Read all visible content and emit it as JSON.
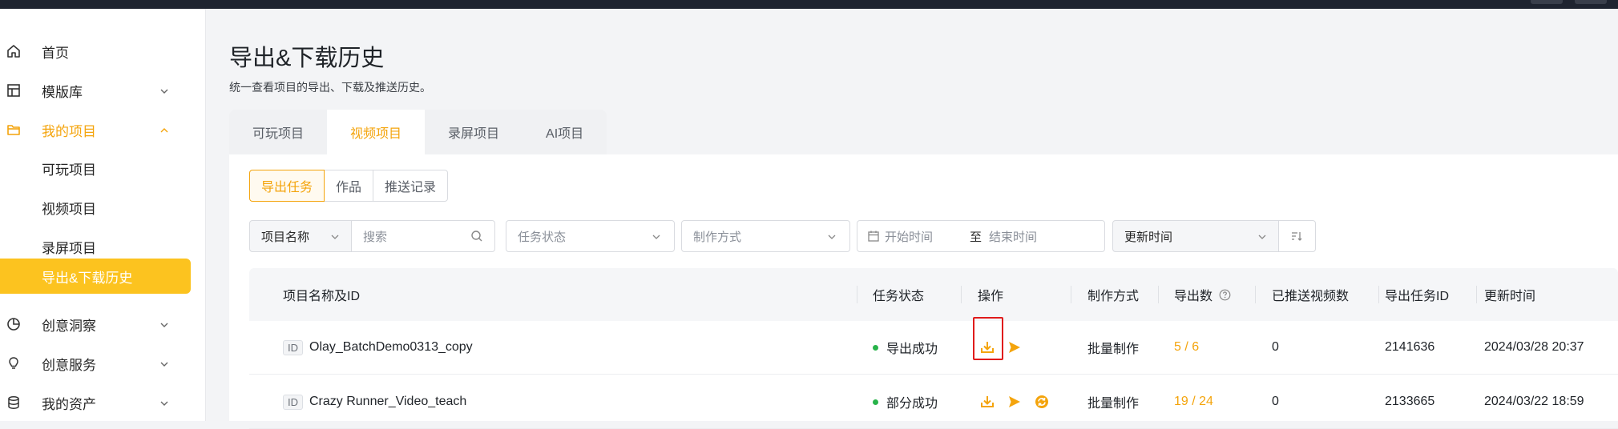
{
  "sidebar": {
    "items": [
      {
        "label": "首页",
        "icon": "home-icon"
      },
      {
        "label": "模版库",
        "icon": "template-icon"
      },
      {
        "label": "我的项目",
        "icon": "folder-icon"
      },
      {
        "label": "可玩项目"
      },
      {
        "label": "视频项目"
      },
      {
        "label": "录屏项目"
      },
      {
        "label": "导出&下载历史"
      },
      {
        "label": "创意洞察",
        "icon": "pie-chart-icon"
      },
      {
        "label": "创意服务",
        "icon": "lightbulb-icon"
      },
      {
        "label": "我的资产",
        "icon": "database-icon"
      }
    ]
  },
  "page": {
    "title": "导出&下载历史",
    "subtitle": "统一查看项目的导出、下载及推送历史。"
  },
  "tabs": [
    "可玩项目",
    "视频项目",
    "录屏项目",
    "AI项目"
  ],
  "segments": [
    "导出任务",
    "作品",
    "推送记录"
  ],
  "filters": {
    "project_name": "项目名称",
    "search_placeholder": "搜索",
    "task_status": "任务状态",
    "make_method": "制作方式",
    "start_time": "开始时间",
    "to": "至",
    "end_time": "结束时间",
    "sort_by": "更新时间"
  },
  "table": {
    "headers": [
      "项目名称及ID",
      "任务状态",
      "操作",
      "制作方式",
      "导出数",
      "已推送视频数",
      "导出任务ID",
      "更新时间"
    ],
    "rows": [
      {
        "id_tag": "ID",
        "name": "Olay_BatchDemo0313_copy",
        "status": "导出成功",
        "method": "批量制作",
        "export_count": "5 / 6",
        "pushed": "0",
        "task_id": "2141636",
        "updated": "2024/03/28 20:37"
      },
      {
        "id_tag": "ID",
        "name": "Crazy Runner_Video_teach",
        "status": "部分成功",
        "method": "批量制作",
        "export_count": "19 / 24",
        "pushed": "0",
        "task_id": "2133665",
        "updated": "2024/03/22 18:59"
      }
    ]
  },
  "colors": {
    "accent": "#f4a40c",
    "selected_nav_bg": "#fcc31f",
    "success_dot": "#28b34a",
    "highlight_box": "#e01b1b"
  }
}
